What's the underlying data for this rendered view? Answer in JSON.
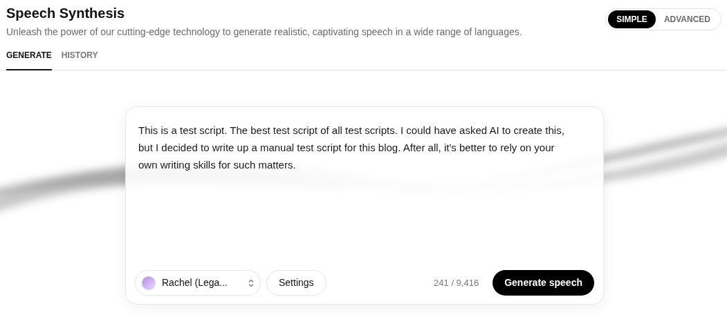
{
  "header": {
    "title": "Speech Synthesis",
    "subtitle": "Unleash the power of our cutting-edge technology to generate realistic, captivating speech in a wide range of languages."
  },
  "mode_toggle": [
    {
      "label": "SIMPLE",
      "selected": true
    },
    {
      "label": "ADVANCED",
      "selected": false
    }
  ],
  "tabs": [
    {
      "label": "GENERATE",
      "selected": true
    },
    {
      "label": "HISTORY",
      "selected": false
    }
  ],
  "editor": {
    "text": "This is a test script. The best test script of all test scripts. I could have asked AI to create this, but I decided to write up a manual test script for this blog. After all, it's better to rely on your own writing skills for such matters.",
    "voice": "Rachel (Lega...",
    "settings_button": "Settings",
    "char_count": "241 / 9,416",
    "generate_button": "Generate speech"
  }
}
